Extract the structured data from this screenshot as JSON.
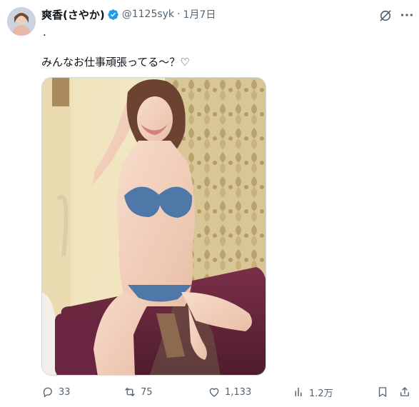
{
  "author": {
    "display_name": "爽香(さやか)",
    "handle": "@1125syk",
    "date": "1月7日",
    "separator": "·"
  },
  "tweet": {
    "period_line": ".",
    "text": "みんなお仕事頑張ってる〜？♡"
  },
  "actions": {
    "reply_count": "33",
    "retweet_count": "75",
    "like_count": "1,133",
    "view_count": "1.2万"
  },
  "colors": {
    "verified_blue": "#1d9bf0",
    "muted_text": "#536471",
    "primary_text": "#0f1419"
  },
  "icons": {
    "verified": "verified-badge-icon",
    "grok": "grok-icon",
    "more": "more-icon",
    "reply": "reply-icon",
    "retweet": "retweet-icon",
    "like": "heart-icon",
    "views": "views-chart-icon",
    "bookmark": "bookmark-icon",
    "share": "share-icon"
  }
}
